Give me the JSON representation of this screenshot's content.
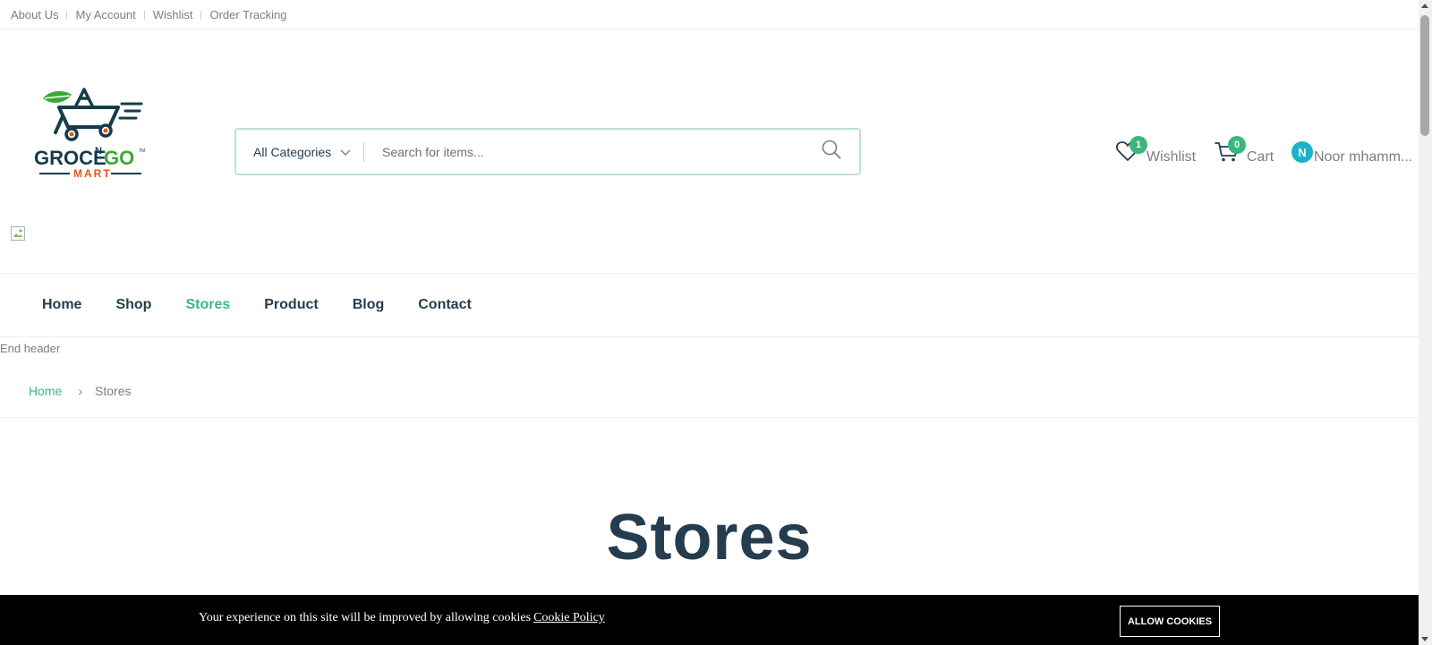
{
  "topbar": {
    "links": [
      "About Us",
      "My Account",
      "Wishlist",
      "Order Tracking"
    ]
  },
  "logo": {
    "brand_text": "GROCE",
    "brand_small": "N",
    "brand_text2": "GO",
    "brand_tm": "TM",
    "brand_sub": "MART"
  },
  "search": {
    "category": "All Categories",
    "placeholder": "Search for items..."
  },
  "header_actions": {
    "wishlist_label": "Wishlist",
    "wishlist_count": "1",
    "cart_label": "Cart",
    "cart_count": "0",
    "user_initial": "N",
    "user_name": "Noor mhamm..."
  },
  "nav": {
    "items": [
      "Home",
      "Shop",
      "Stores",
      "Product",
      "Blog",
      "Contact"
    ],
    "active": "Stores"
  },
  "end_header_text": "End header",
  "breadcrumb": {
    "home": "Home",
    "separator": "›",
    "current": "Stores"
  },
  "page_title": "Stores",
  "cookie": {
    "text": "Your experience on this site will be improved by allowing cookies",
    "link": "Cookie Policy",
    "button": "ALLOW COOKIES"
  },
  "colors": {
    "brand_green": "#3bb77e",
    "heading": "#253d4e",
    "muted": "#7e7e7e",
    "search_border": "#bce3c9",
    "avatar": "#1ab4c8",
    "logo_orange": "#e8561c"
  },
  "icons": [
    "search-icon",
    "heart-icon",
    "cart-icon",
    "chevron-down-icon",
    "broken-image-icon"
  ]
}
